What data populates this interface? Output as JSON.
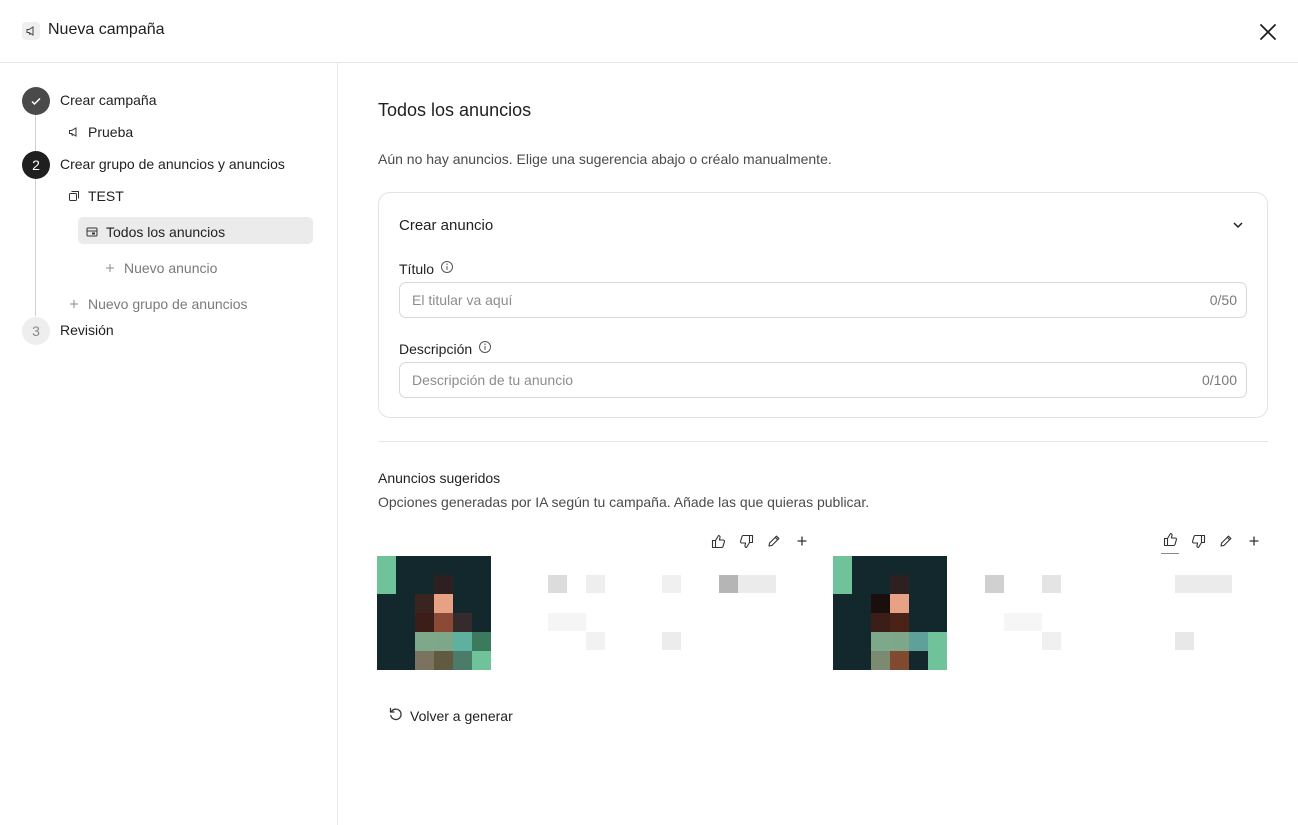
{
  "header": {
    "title": "Nueva campaña"
  },
  "sidebar": {
    "steps": [
      {
        "label": "Crear campaña",
        "state": "done",
        "marker": "✓"
      },
      {
        "label": "Crear grupo de anuncios y anuncios",
        "state": "active",
        "marker": "2"
      },
      {
        "label": "Revisión",
        "state": "todo",
        "marker": "3"
      }
    ],
    "campaign_name": "Prueba",
    "ad_group_name": "TEST",
    "all_ads": "Todos los anuncios",
    "new_ad": "Nuevo anuncio",
    "new_ad_group": "Nuevo grupo de anuncios"
  },
  "main": {
    "title": "Todos los anuncios",
    "subtitle": "Aún no hay anuncios. Elige una sugerencia abajo o créalo manualmente.",
    "create_card": {
      "title": "Crear anuncio",
      "title_field": {
        "label": "Título",
        "placeholder": "El titular va aquí",
        "counter": "0/50"
      },
      "description_field": {
        "label": "Descripción",
        "placeholder": "Descripción de tu anuncio",
        "counter": "0/100"
      }
    },
    "suggested": {
      "title": "Anuncios sugeridos",
      "subtitle": "Opciones generadas por IA según tu campaña. Añade las que quieras publicar."
    },
    "regenerate_label": "Volver a generar"
  },
  "colors": {
    "accent_dark": "#1f1f1f",
    "done_step": "#4a4a4a",
    "selected_bg": "#ebebeb",
    "border": "#e3e3e3"
  }
}
